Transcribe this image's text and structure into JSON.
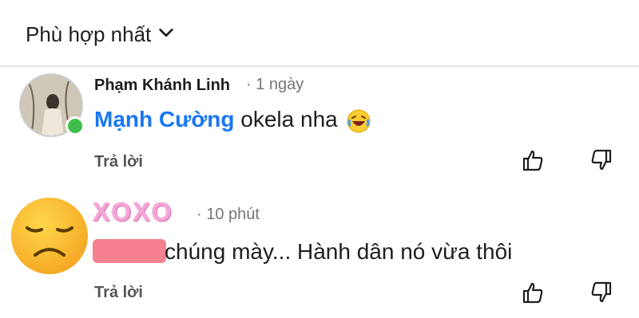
{
  "sort": {
    "label": "Phù hợp nhất"
  },
  "comments": [
    {
      "author": "Phạm Khánh Linh",
      "time": "· 1 ngày",
      "mention": "Mạnh Cường",
      "text": " okela nha",
      "reply_label": "Trả lời",
      "online": true
    },
    {
      "author_stylized": "XOXO",
      "time": "· 10 phút",
      "text": "chúng mày... Hành dân nó vừa thôi",
      "reply_label": "Trả lời"
    }
  ],
  "colors": {
    "mention": "#1877f2",
    "online": "#3fbf4a",
    "redaction": "#f36b7a"
  },
  "icons": [
    "chevron-down-icon",
    "thumbs-up-icon",
    "thumbs-down-icon",
    "laughing-emoji-icon",
    "sad-emoji-icon"
  ]
}
